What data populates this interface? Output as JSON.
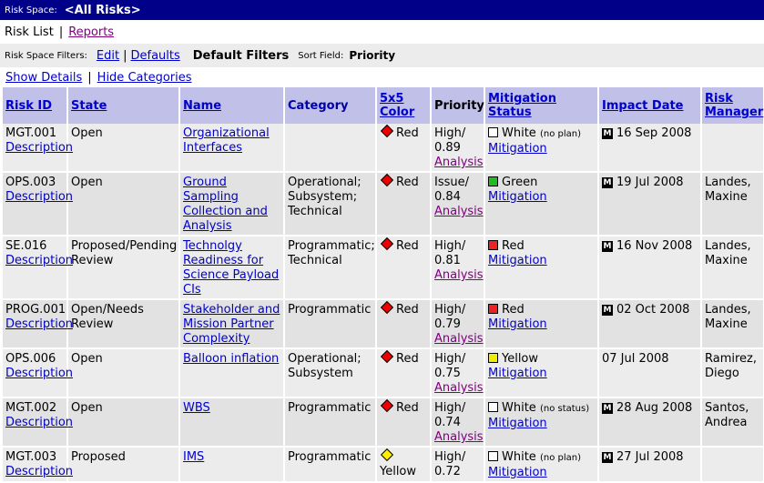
{
  "header": {
    "risk_space_label": "Risk Space:",
    "risk_space_value": "<All Risks>"
  },
  "nav": {
    "risk_list": "Risk List",
    "separator": "|",
    "reports": "Reports"
  },
  "filters": {
    "label": "Risk Space Filters:",
    "edit": "Edit",
    "separator": "|",
    "defaults": "Defaults",
    "default_filters": "Default Filters",
    "sort_label": "Sort Field:",
    "sort_value": "Priority"
  },
  "details": {
    "show": "Show Details",
    "separator": "|",
    "hide": "Hide Categories"
  },
  "columns": {
    "risk_id": "Risk ID",
    "state": "State",
    "name": "Name",
    "category": "Category",
    "color_line1": "5x5",
    "color_line2": "Color",
    "priority": "Priority",
    "mitigation_line1": "Mitigation",
    "mitigation_line2": "Status",
    "impact_date": "Impact Date",
    "manager_line1": "Risk",
    "manager_line2": "Manager"
  },
  "rows": [
    {
      "id": "MGT.001",
      "desc": "Description",
      "state_l1": "Open",
      "state_l2": "",
      "name_l1": "Organizational",
      "name_l2": "Interfaces",
      "name_l3": "",
      "name_l4": "",
      "cat_l1": "",
      "cat_l2": "",
      "cat_l3": "",
      "color": "Red",
      "color_hex": "#ee0000",
      "prio_l1": "High/",
      "prio_l2": "0.89",
      "analysis": "Analysis",
      "mit_status": "White",
      "mit_note": "(no plan)",
      "mit_hex": "#ffffff",
      "mitigation": "Mitigation",
      "badge": "M",
      "impact": "16 Sep 2008",
      "mgr_l1": "",
      "mgr_l2": ""
    },
    {
      "id": "OPS.003",
      "desc": "Description",
      "state_l1": "Open",
      "state_l2": "",
      "name_l1": "Ground Sampling",
      "name_l2": "Collection and",
      "name_l3": "Analysis",
      "name_l4": "",
      "cat_l1": "Operational;",
      "cat_l2": "Subsystem;",
      "cat_l3": "Technical",
      "color": "Red",
      "color_hex": "#ee0000",
      "prio_l1": "Issue/",
      "prio_l2": "0.84",
      "analysis": "Analysis",
      "mit_status": "Green",
      "mit_note": "",
      "mit_hex": "#22bb22",
      "mitigation": "Mitigation",
      "badge": "M",
      "impact": "19 Jul 2008",
      "mgr_l1": "Landes,",
      "mgr_l2": "Maxine"
    },
    {
      "id": "SE.016",
      "desc": "Description",
      "state_l1": "Proposed/Pending",
      "state_l2": "Review",
      "name_l1": "Technolgy",
      "name_l2": "Readiness for",
      "name_l3": "Science Payload",
      "name_l4": "CIs",
      "cat_l1": "Programmatic;",
      "cat_l2": "Technical",
      "cat_l3": "",
      "color": "Red",
      "color_hex": "#ee0000",
      "prio_l1": "High/",
      "prio_l2": "0.81",
      "analysis": "Analysis",
      "mit_status": "Red",
      "mit_note": "",
      "mit_hex": "#ee2222",
      "mitigation": "Mitigation",
      "badge": "M",
      "impact": "16 Nov 2008",
      "mgr_l1": "Landes,",
      "mgr_l2": "Maxine"
    },
    {
      "id": "PROG.001",
      "desc": "Description",
      "state_l1": "Open/Needs",
      "state_l2": "Review",
      "name_l1": "Stakeholder and",
      "name_l2": "Mission Partner",
      "name_l3": "Complexity",
      "name_l4": "",
      "cat_l1": "Programmatic",
      "cat_l2": "",
      "cat_l3": "",
      "color": "Red",
      "color_hex": "#ee0000",
      "prio_l1": "High/",
      "prio_l2": "0.79",
      "analysis": "Analysis",
      "mit_status": "Red",
      "mit_note": "",
      "mit_hex": "#ee2222",
      "mitigation": "Mitigation",
      "badge": "M",
      "impact": "02 Oct 2008",
      "mgr_l1": "Landes,",
      "mgr_l2": "Maxine"
    },
    {
      "id": "OPS.006",
      "desc": "Description",
      "state_l1": "Open",
      "state_l2": "",
      "name_l1": "Balloon inflation",
      "name_l2": "",
      "name_l3": "",
      "name_l4": "",
      "cat_l1": "Operational;",
      "cat_l2": "Subsystem",
      "cat_l3": "",
      "color": "Red",
      "color_hex": "#ee0000",
      "prio_l1": "High/",
      "prio_l2": "0.75",
      "analysis": "Analysis",
      "mit_status": "Yellow",
      "mit_note": "",
      "mit_hex": "#eeee00",
      "mitigation": "Mitigation",
      "badge": "",
      "impact": "07 Jul 2008",
      "mgr_l1": "Ramirez,",
      "mgr_l2": "Diego"
    },
    {
      "id": "MGT.002",
      "desc": "Description",
      "state_l1": "Open",
      "state_l2": "",
      "name_l1": "WBS",
      "name_l2": "",
      "name_l3": "",
      "name_l4": "",
      "cat_l1": "Programmatic",
      "cat_l2": "",
      "cat_l3": "",
      "color": "Red",
      "color_hex": "#ee0000",
      "prio_l1": "High/",
      "prio_l2": "0.74",
      "analysis": "Analysis",
      "mit_status": "White",
      "mit_note": "(no status)",
      "mit_hex": "#ffffff",
      "mitigation": "Mitigation",
      "badge": "M",
      "impact": "28 Aug 2008",
      "mgr_l1": "Santos,",
      "mgr_l2": "Andrea"
    },
    {
      "id": "MGT.003",
      "desc": "Description",
      "state_l1": "Proposed",
      "state_l2": "",
      "name_l1": "IMS",
      "name_l2": "",
      "name_l3": "",
      "name_l4": "",
      "cat_l1": "Programmatic",
      "cat_l2": "",
      "cat_l3": "",
      "color": "Yellow",
      "color_hex": "#ffee00",
      "prio_l1": "High/",
      "prio_l2": "0.72",
      "analysis": "",
      "mit_status": "White",
      "mit_note": "(no plan)",
      "mit_hex": "#ffffff",
      "mitigation": "Mitigation",
      "badge": "M",
      "impact": "27 Jul 2008",
      "mgr_l1": "",
      "mgr_l2": ""
    }
  ]
}
